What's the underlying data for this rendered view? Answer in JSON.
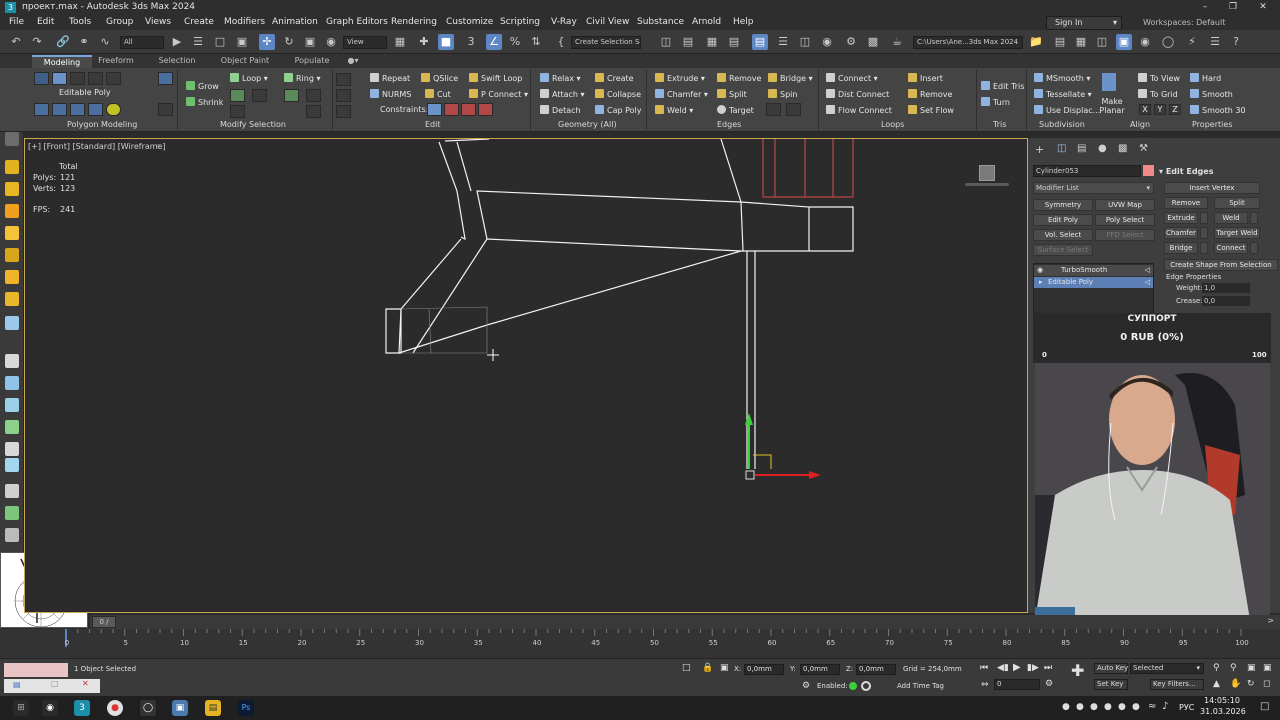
{
  "window": {
    "title": "проект.max - Autodesk 3ds Max 2024"
  },
  "menu": [
    "File",
    "Edit",
    "Tools",
    "Group",
    "Views",
    "Create",
    "Modifiers",
    "Animation",
    "Graph Editors",
    "Rendering",
    "Customize",
    "Scripting",
    "V-Ray",
    "Civil View",
    "Substance",
    "Arnold",
    "Help"
  ],
  "account": {
    "sign_in": "Sign In",
    "workspaces": "Workspaces: Default"
  },
  "toolbar": {
    "selection_filter": "All",
    "view_dropdown": "View",
    "create_selection_set": "Create Selection Se",
    "project_path": "C:\\Users\\Ane...3ds Max 2024"
  },
  "ribbon": {
    "tabs": [
      "Modeling",
      "Freeform",
      "Selection",
      "Object Paint",
      "Populate"
    ],
    "active_tab": "Modeling",
    "editable_poly_label": "Editable Poly",
    "grow": "Grow",
    "shrink": "Shrink",
    "loop": "Loop",
    "ring": "Ring",
    "repeat": "Repeat",
    "qslice": "QSlice",
    "swift_loop": "Swift Loop",
    "nurms": "NURMS",
    "cut": "Cut",
    "p_connect": "P Connect",
    "constraints": "Constraints:",
    "relax": "Relax",
    "create": "Create",
    "attach": "Attach",
    "collapse": "Collapse",
    "detach": "Detach",
    "cap_poly": "Cap Poly",
    "extrude": "Extrude",
    "remove": "Remove",
    "bridge": "Bridge",
    "chamfer": "Chamfer",
    "split": "Split",
    "spin": "Spin",
    "weld": "Weld",
    "target": "Target",
    "connect": "Connect",
    "insert": "Insert",
    "dist_connect": "Dist Connect",
    "remove2": "Remove",
    "flow_connect": "Flow Connect",
    "set_flow": "Set Flow",
    "edit_tris": "Edit Tris",
    "turn": "Turn",
    "msmooth": "MSmooth",
    "tessellate": "Tessellate",
    "use_displac": "Use Displac...",
    "make_planar": "Make Planar",
    "to_view": "To View",
    "to_grid": "To Grid",
    "x": "X",
    "y": "Y",
    "z": "Z",
    "hard": "Hard",
    "smooth": "Smooth",
    "smooth30": "Smooth 30",
    "sections": {
      "polygon_modeling": "Polygon Modeling",
      "modify_selection": "Modify Selection",
      "edit": "Edit",
      "geometry_all": "Geometry (All)",
      "edges": "Edges",
      "loops": "Loops",
      "tris": "Tris",
      "subdivision": "Subdivision",
      "align": "Align",
      "properties": "Properties"
    }
  },
  "viewport": {
    "label": "[+] [Front] [Standard] [Wireframe]",
    "stats": {
      "total": "Total",
      "polys": "Polys:",
      "polys_v": "121",
      "verts": "Verts:",
      "verts_v": "123",
      "fps": "FPS:",
      "fps_v": "241"
    }
  },
  "command_panel": {
    "object_name": "Cylinder053",
    "modifier_list": "Modifier List",
    "buttons": [
      "Symmetry",
      "UVW Map",
      "Edit Poly",
      "Poly Select",
      "Vol. Select",
      "FFD Select",
      "Surface Select"
    ],
    "stack": [
      "TurboSmooth",
      "Editable Poly"
    ],
    "edit_edges": {
      "title": "Edit Edges",
      "insert_vertex": "Insert Vertex",
      "remove": "Remove",
      "split": "Split",
      "extrude": "Extrude",
      "weld": "Weld",
      "chamfer": "Chamfer",
      "target_weld": "Target Weld",
      "bridge": "Bridge",
      "connect": "Connect",
      "create_shape": "Create Shape From Selection",
      "edge_properties": "Edge Properties",
      "weight_label": "Weight:",
      "weight": "1,0",
      "crease_label": "Crease:",
      "crease": "0,0"
    }
  },
  "donation": {
    "title": "СУППОРТ",
    "amount": "0 RUB (0%)",
    "min": "0",
    "max": "100"
  },
  "timeline": {
    "frame": "0 / 100",
    "ticks": [
      "0",
      "5",
      "10",
      "15",
      "20",
      "25",
      "30",
      "35",
      "40",
      "45",
      "50",
      "55",
      "60",
      "65",
      "70",
      "75",
      "80",
      "85",
      "90",
      "95",
      "100"
    ]
  },
  "status": {
    "selection": "1 Object Selected",
    "x_label": "X:",
    "x": "0,0mm",
    "y_label": "Y:",
    "y": "0,0mm",
    "z_label": "Z:",
    "z": "0,0mm",
    "grid": "Grid = 254,0mm",
    "enabled": "Enabled:",
    "add_time_tag": "Add Time Tag",
    "auto_key": "Auto Key",
    "selected": "Selected",
    "set_key": "Set Key",
    "key_filters": "Key Filters...",
    "frame_field": "0"
  },
  "taskbar": {
    "lang": "РУС",
    "time": "14:05:10",
    "date": "31.03.2026"
  },
  "colors": {
    "accent": "#5d86c4",
    "viewport_border": "#c9a94b",
    "object_color": "#f08a8a"
  }
}
